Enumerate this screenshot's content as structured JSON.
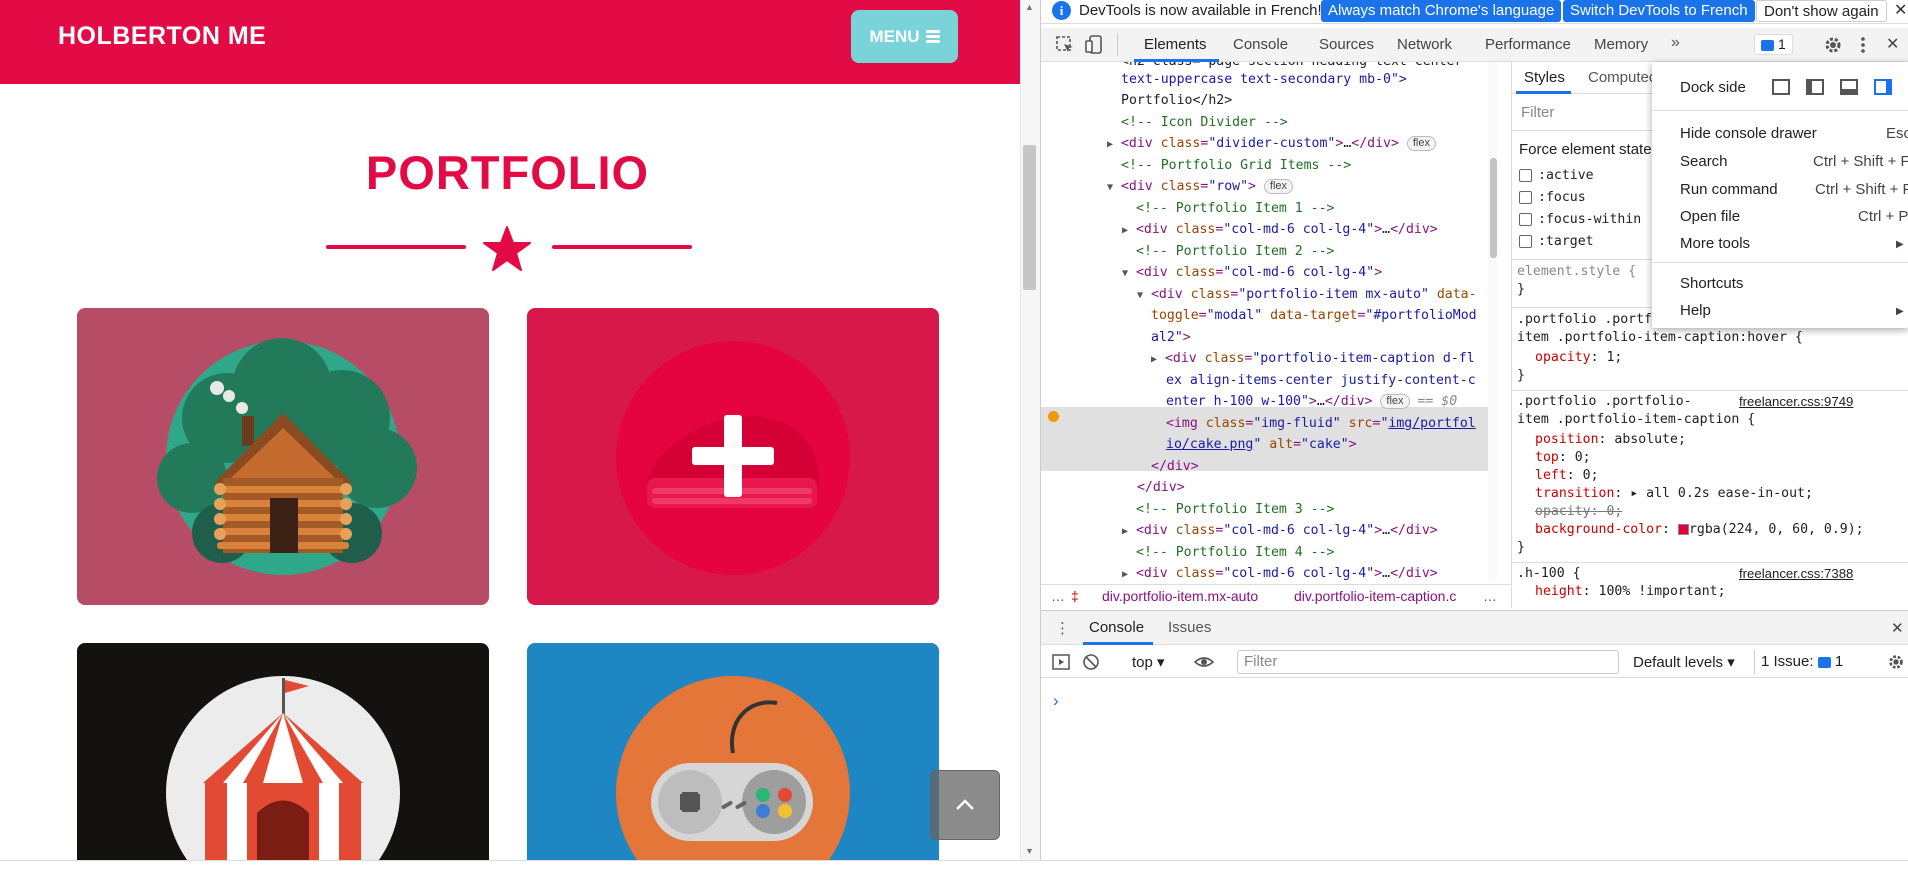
{
  "site": {
    "brand": "HOLBERTON ME",
    "menu_label": "MENU",
    "portfolio_title": "PORTFOLIO",
    "colors": {
      "primary": "#e30b45",
      "menu_button": "#7ad3d9"
    }
  },
  "devtools": {
    "infobar": {
      "message": "DevTools is now available in French!",
      "btn_match": "Always match Chrome's language",
      "btn_switch": "Switch DevTools to French",
      "btn_dont": "Don't show again"
    },
    "tabs": [
      "Elements",
      "Console",
      "Sources",
      "Network",
      "Performance",
      "Memory"
    ],
    "issues_count": "1",
    "dom_lines": {
      "l0": "text-uppercase text-secondary mb-0\">",
      "l1": "Portfolio</h2>",
      "l2": "<!-- Icon Divider -->",
      "l3": "<!-- Portfolio Grid Items -->",
      "l4": "<!-- Portfolio Item 1 -->",
      "l5": "<!-- Portfolio Item 2 -->",
      "l6": "<!-- Portfolio Item 3 -->",
      "l7": "<!-- Portfolio Item 4 -->",
      "flex_badge": "flex",
      "eq_sel": "== $0"
    },
    "breadcrumbs": [
      "div.portfolio-item.mx-auto",
      "div.portfolio-item-caption.c"
    ],
    "styles": {
      "tab_styles": "Styles",
      "tab_computed": "Computed",
      "filter_placeholder": "Filter",
      "force_state": "Force element state",
      "pseudo": [
        ":active",
        ":focus",
        ":focus-within",
        ":target"
      ],
      "element_style": "element.style {",
      "rule1_selector_a": ".portfolio .portfo",
      "rule1_selector_b": "item .portfolio-item-caption:hover {",
      "rule1_prop": "opacity",
      "rule1_value": "1;",
      "rule2_selector_a": ".portfolio .portfolio-",
      "rule2_selector_b": "item .portfolio-item-caption {",
      "rule2_source": "freelancer.css:9749",
      "rule2_props": [
        {
          "name": "position",
          "value": "absolute;"
        },
        {
          "name": "top",
          "value": "0;"
        },
        {
          "name": "left",
          "value": "0;"
        },
        {
          "name": "transition",
          "value": "all 0.2s ease-in-out;"
        },
        {
          "name": "opacity",
          "value": "0;"
        },
        {
          "name": "background-color",
          "value": "rgba(224, 0, 60, 0.9);"
        }
      ],
      "rule3_selector": ".h-100 {",
      "rule3_source": "freelancer.css:7388",
      "rule3_prop": "height",
      "rule3_value": "100% !important;",
      "close_brace": "}"
    },
    "menu": {
      "dock_side": "Dock side",
      "items": [
        {
          "label": "Hide console drawer",
          "shortcut": "Esc"
        },
        {
          "label": "Search",
          "shortcut": "Ctrl + Shift + F"
        },
        {
          "label": "Run command",
          "shortcut": "Ctrl + Shift + P"
        },
        {
          "label": "Open file",
          "shortcut": "Ctrl + P"
        },
        {
          "label": "More tools",
          "shortcut": ""
        },
        {
          "label": "Shortcuts",
          "shortcut": ""
        },
        {
          "label": "Help",
          "shortcut": ""
        }
      ]
    },
    "drawer": {
      "tab_console": "Console",
      "tab_issues": "Issues",
      "context": "top",
      "filter_placeholder": "Filter",
      "levels": "Default levels",
      "issues_label": "1 Issue:",
      "issues_count": "1"
    }
  }
}
